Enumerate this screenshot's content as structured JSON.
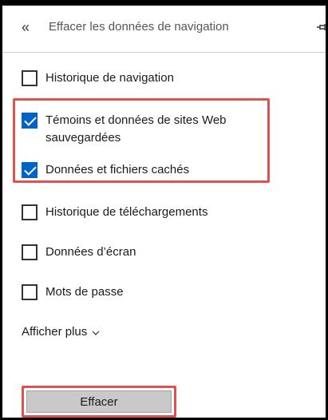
{
  "panel": {
    "title": "Effacer les données de navigation",
    "back_icon": "double-chevron-left-icon",
    "pin_icon": "pin-icon"
  },
  "options": [
    {
      "label": "Historique de navigation",
      "checked": false
    },
    {
      "label_line1": "Témoins et données de sites Web",
      "label_line2": "sauvegardées",
      "checked": true
    },
    {
      "label": "Données et fichiers cachés",
      "checked": true
    },
    {
      "label": "Historique de téléchargements",
      "checked": false
    },
    {
      "label": "Données d’écran",
      "checked": false
    },
    {
      "label": "Mots de passe",
      "checked": false
    }
  ],
  "show_more": {
    "label": "Afficher plus"
  },
  "clear_button": {
    "label": "Effacer"
  },
  "colors": {
    "checkbox_checked": "#0063c7",
    "highlight": "#e0504f",
    "button_bg": "#c9c9c9"
  }
}
